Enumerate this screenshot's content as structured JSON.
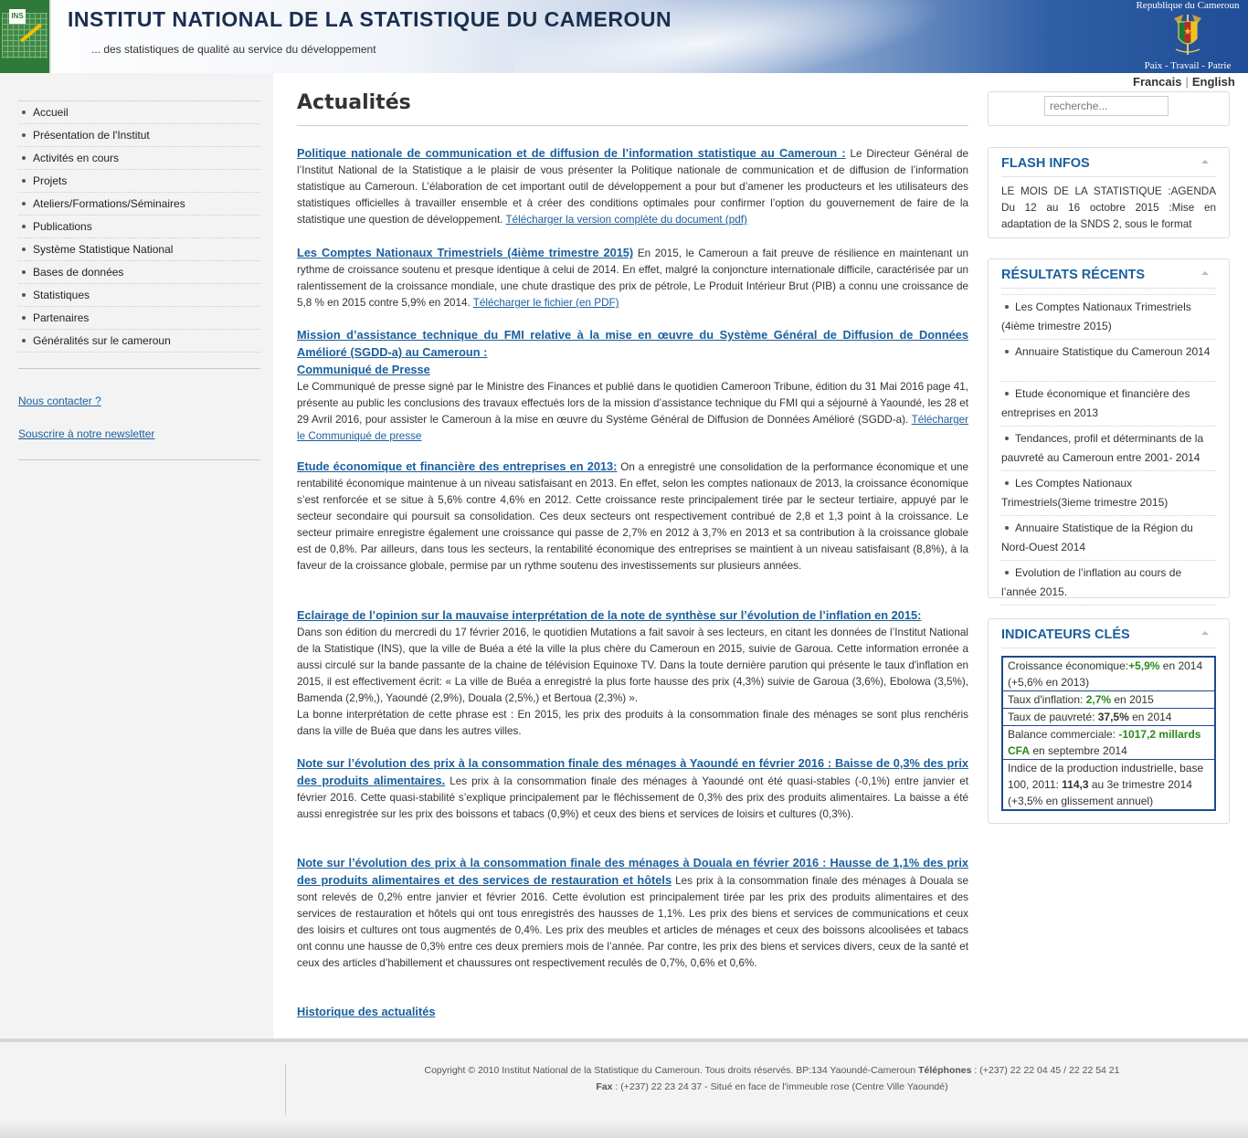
{
  "header": {
    "title": "INSTITUT NATIONAL DE LA STATISTIQUE DU CAMEROUN",
    "tagline": "... des statistiques de qualité au service du développement",
    "logo_text": "INS",
    "republic": "Republique du Cameroun",
    "motto": "Paix - Travail - Patrie",
    "emblem_icon": "coat-of-arms-icon",
    "colors": {
      "brand_blue": "#1f4d97",
      "link": "#1a5f9e",
      "green": "#2a8a1a"
    }
  },
  "lang": {
    "fr": "Francais",
    "sep": "|",
    "en": "English"
  },
  "nav": {
    "items": [
      {
        "label": "Accueil"
      },
      {
        "label": "Présentation de l'Institut"
      },
      {
        "label": "Activités en cours"
      },
      {
        "label": "Projets"
      },
      {
        "label": "Ateliers/Formations/Séminaires"
      },
      {
        "label": "Publications"
      },
      {
        "label": "Système Statistique National"
      },
      {
        "label": "Bases de données"
      },
      {
        "label": "Statistiques"
      },
      {
        "label": "Partenaires"
      },
      {
        "label": "Généralités sur le cameroun"
      }
    ],
    "contact": "Nous contacter ?",
    "newsletter": "Souscrire à notre newsletter"
  },
  "main": {
    "title": "Actualités",
    "news": [
      {
        "title": "Politique nationale de communication et de diffusion de l’information statistique au Cameroun :",
        "body": " Le Directeur Général de l’Institut National de la Statistique a le plaisir de vous présenter la Politique nationale de communication et de diffusion de l’information statistique au Cameroun. L’élaboration de cet important outil de développement a pour but d’amener les producteurs et les utilisateurs des statistiques officielles à travailler ensemble et à créer des conditions optimales pour confirmer l’option du gouvernement de faire de la statistique une question de développement. ",
        "link": "Télécharger la version complète du document (pdf)"
      },
      {
        "title": "Les Comptes Nationaux Trimestriels (4ième trimestre 2015)",
        "body": " En 2015, le Cameroun a fait preuve de résilience en maintenant un rythme de croissance soutenu et presque identique à celui de 2014. En effet, malgré la conjoncture internationale difficile, caractérisée par un ralentissement de la croissance mondiale, une chute drastique des prix de pétrole, Le Produit Intérieur Brut (PIB) a connu une croissance de 5,8 % en 2015 contre 5,9% en 2014. ",
        "link": "Télécharger le fichier (en PDF)"
      },
      {
        "title": "Mission d’assistance technique du FMI relative à la mise en œuvre du Système Général de Diffusion de Données Amélioré (SGDD-a) au Cameroun :",
        "subtitle": "Communiqué de Presse",
        "body": "Le Communiqué de presse signé par le Ministre des Finances et publié dans le quotidien Cameroon Tribune, édition du 31 Mai 2016 page 41, présente au public les conclusions des travaux effectués lors de la mission d’assistance technique du FMI qui a séjourné à Yaoundé, les 28 et 29 Avril 2016, pour assister le Cameroun à la mise en œuvre du Système Général de Diffusion de Données Amélioré (SGDD-a). ",
        "link": "Télécharger le Communiqué de presse "
      },
      {
        "title": "Etude économique et financière des entreprises en 2013:",
        "body": " On a enregistré une consolidation de la performance économique et une rentabilité économique maintenue à un niveau satisfaisant en 2013. En effet, selon les comptes nationaux de 2013, la croissance économique s’est renforcée et se situe à 5,6% contre 4,6% en 2012. Cette croissance reste principalement tirée par le secteur tertiaire, appuyé par le secteur secondaire qui poursuit sa consolidation. Ces deux secteurs ont respectivement contribué de 2,8 et 1,3 point à la croissance. Le secteur primaire enregistre également une croissance qui passe de 2,7% en 2012 à 3,7% en 2013 et sa contribution à la croissance globale est de 0,8%. Par ailleurs, dans tous les secteurs, la rentabilité économique des entreprises se maintient à un niveau satisfaisant (8,8%), à la faveur de la croissance globale, permise par un rythme soutenu des investissements sur plusieurs années."
      },
      {
        "title": "Eclairage de l’opinion sur la mauvaise interprétation de la note de synthèse sur l’évolution de l’inflation en 2015:",
        "body": "Dans son édition du mercredi du 17 février 2016, le quotidien Mutations a fait savoir à ses lecteurs, en citant les données de l’Institut National de la Statistique (INS), que la ville de Buéa a été la ville la plus chère du Cameroun en 2015, suivie de Garoua. Cette information erronée a aussi circulé sur la bande passante de la chaine de télévision Equinoxe TV. Dans la toute dernière parution qui présente le taux d'inflation en 2015, il est effectivement écrit: « La ville de Buéa a enregistré la plus forte hausse des prix (4,3%) suivie de Garoua (3,6%), Ebolowa (3,5%), Bamenda (2,9%,), Yaoundé (2,9%), Douala (2,5%,) et Bertoua (2,3%) ».",
        "body2": "La bonne interprétation de cette phrase est : En 2015, les prix des produits à la consommation finale des ménages se sont plus renchéris dans la ville de Buéa que dans les autres villes."
      },
      {
        "title": "Note sur l’évolution des prix à la consommation finale des ménages à Yaoundé en février 2016 : Baisse de 0,3% des prix des produits alimentaires.",
        "body": " Les prix à la consommation finale des ménages à Yaoundé ont été quasi-stables (-0,1%) entre janvier et février 2016. Cette quasi-stabilité s’explique principalement par le fléchissement de 0,3% des prix des produits alimentaires. La baisse a été aussi enregistrée sur les prix des boissons et tabacs (0,9%) et ceux des biens et services de loisirs et cultures (0,3%)."
      },
      {
        "title": "Note sur l’évolution des prix à la consommation finale des ménages à Douala en février 2016 : Hausse de 1,1% des prix des produits alimentaires et des services de restauration et hôtels",
        "body": " Les prix à la consommation finale des ménages à Douala se sont relevés de 0,2% entre janvier et février 2016. Cette évolution est principalement tirée par les prix des produits alimentaires et des services de restauration et hôtels qui ont tous enregistrés des hausses de 1,1%. Les prix des biens et services de communications et ceux des loisirs et cultures ont tous augmentés de 0,4%. Les prix des meubles et articles de ménages et ceux des boissons alcoolisées et tabacs ont connu une hausse de 0,3% entre ces deux premiers mois de l’année. Par contre, les prix des biens et services divers, ceux de la santé et ceux des articles d’habillement et chaussures ont respectivement reculés de 0,7%, 0,6% et 0,6%."
      }
    ],
    "history": "Historique des actualités"
  },
  "right": {
    "search_placeholder": "recherche...",
    "flash": {
      "title": "FLASH INFOS",
      "text": "LE MOIS DE LA STATISTIQUE :AGENDA Du 12 au 16 octobre 2015 :Mise en adaptation de la SNDS 2, sous le format"
    },
    "results": {
      "title": "RÉSULTATS RÉCENTS",
      "items": [
        "Les Comptes Nationaux Trimestriels (4ième trimestre 2015)",
        "Annuaire Statistique du Cameroun 2014",
        "Etude économique et financière des entreprises en 2013",
        "Tendances, profil et déterminants de la pauvreté au Cameroun entre 2001- 2014",
        "Les Comptes Nationaux Trimestriels(3ieme trimestre 2015)",
        "Annuaire Statistique de la Région du Nord-Ouest 2014",
        "Evolution de l’inflation au cours de l’année 2015."
      ]
    },
    "indicators": {
      "title": "INDICATEURS CLÉS",
      "rows": [
        {
          "pre": "Croissance économique:",
          "val": "+5,9%",
          "post": " en 2014 (+5,6% en 2013)",
          "style": "green"
        },
        {
          "pre": "Taux d'inflation: ",
          "val": "2,7%",
          "post": " en 2015",
          "style": "green"
        },
        {
          "pre": "Taux de pauvreté: ",
          "val": "37,5%",
          "post": " en 2014",
          "style": "bold"
        },
        {
          "pre": "Balance commerciale: ",
          "val": "-1017,2 millards CFA",
          "post": " en septembre 2014",
          "style": "green"
        },
        {
          "pre": "Indice de la production industrielle, base 100, 2011: ",
          "val": "114,3",
          "post": " au 3e trimestre 2014 (+3,5% en glissement annuel)",
          "style": "bold"
        }
      ]
    }
  },
  "footer": {
    "line1_a": "Copyright © 2010 Institut National de la Statistique du Cameroun. Tous droits réservés. BP:134 Yaoundé-Cameroun ",
    "line1_label": "Téléphones",
    "line1_b": " : (+237) 22 22 04 45 / 22 22 54 21",
    "line2_label": "Fax",
    "line2_b": " : (+237) 22 23 24 37 - Situé en face de l'immeuble rose (Centre Ville Yaoundé)"
  }
}
